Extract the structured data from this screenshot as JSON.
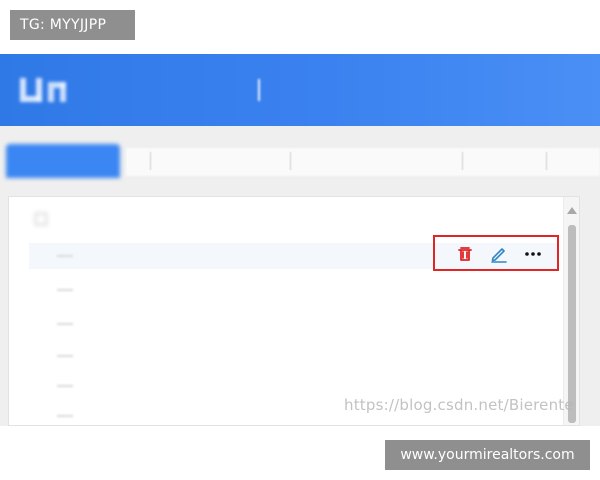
{
  "top_tag": {
    "text": "TG: MYYJJPP"
  },
  "app": {
    "header_title": "",
    "header_subtitle": "",
    "tabs": [
      {
        "label": ""
      },
      {
        "label": ""
      },
      {
        "label": ""
      },
      {
        "label": ""
      },
      {
        "label": ""
      }
    ],
    "tree": {
      "root_label": "",
      "rows": [
        {
          "label": ""
        },
        {
          "label": ""
        },
        {
          "label": ""
        },
        {
          "label": ""
        },
        {
          "label": ""
        },
        {
          "label": ""
        }
      ]
    },
    "row_actions": [
      {
        "icon": "trash-icon",
        "color": "#e02525"
      },
      {
        "icon": "pencil-icon",
        "color": "#2f86c8"
      },
      {
        "icon": "more-icon",
        "color": "#111111"
      }
    ],
    "highlight_color": "#e02525",
    "header_color": "#3b82f0"
  },
  "watermark": {
    "text": "https://blog.csdn.net/Bierente"
  },
  "bottom_tag": {
    "text": "www.yourmirealtors.com"
  }
}
